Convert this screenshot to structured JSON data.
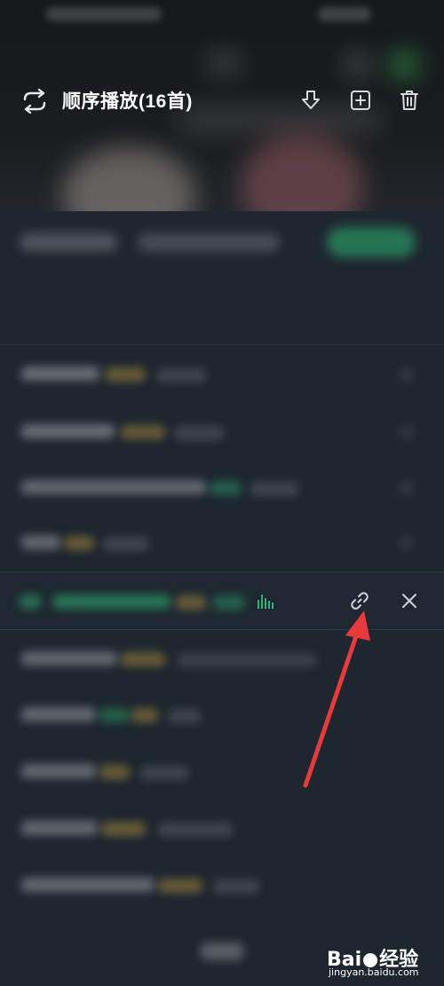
{
  "playlist": {
    "mode_label": "顺序播放(16首)",
    "mode_icon": "loop-icon",
    "actions": [
      {
        "name": "download-all-icon"
      },
      {
        "name": "add-to-playlist-icon"
      },
      {
        "name": "clear-list-icon"
      }
    ]
  },
  "active_song": {
    "icons": [
      "playing-equalizer-icon",
      "link-icon",
      "close-icon"
    ]
  },
  "watermark": {
    "brand_left": "Bai",
    "brand_right": "经验",
    "url": "jingyan.baidu.com"
  },
  "colors": {
    "accent_green": "#2bb673",
    "annotation_red": "#e83a3a",
    "sheet_bg": "#1e2630"
  }
}
